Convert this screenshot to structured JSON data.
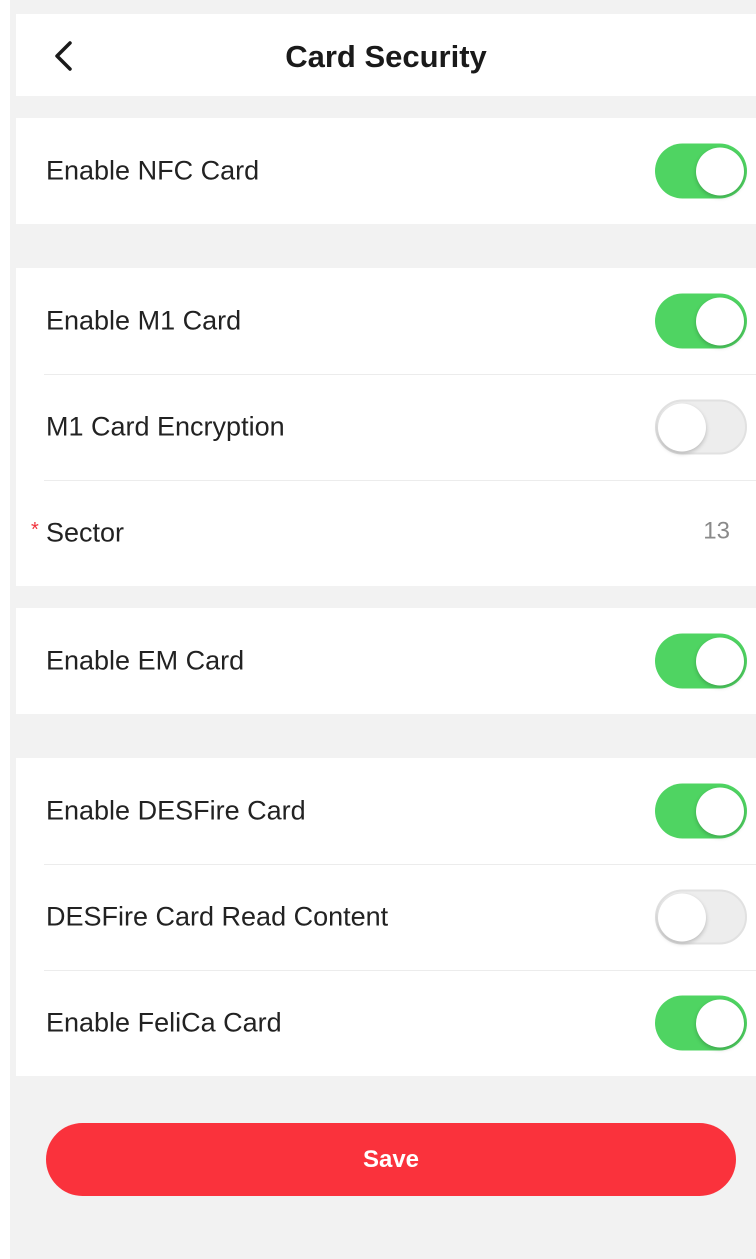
{
  "header": {
    "title": "Card Security",
    "back_icon": "chevron-left-icon"
  },
  "sections": [
    {
      "rows": [
        {
          "label": "Enable NFC Card",
          "control": "toggle",
          "on": true
        }
      ]
    },
    {
      "rows": [
        {
          "label": "Enable M1 Card",
          "control": "toggle",
          "on": true
        },
        {
          "label": "M1 Card Encryption",
          "control": "toggle",
          "on": false
        },
        {
          "label": "Sector",
          "required_mark": "*",
          "control": "value",
          "value": "13"
        }
      ]
    },
    {
      "rows": [
        {
          "label": "Enable EM Card",
          "control": "toggle",
          "on": true
        }
      ]
    },
    {
      "rows": [
        {
          "label": "Enable DESFire Card",
          "control": "toggle",
          "on": true
        },
        {
          "label": "DESFire Card Read Content",
          "control": "toggle",
          "on": false
        },
        {
          "label": "Enable FeliCa Card",
          "control": "toggle",
          "on": true
        }
      ]
    }
  ],
  "save_label": "Save",
  "colors": {
    "toggle_on": "#4fd462",
    "toggle_off": "#ededed",
    "save_button": "#fa323c",
    "required_star": "#f0323c",
    "page_background": "#f2f2f2"
  }
}
